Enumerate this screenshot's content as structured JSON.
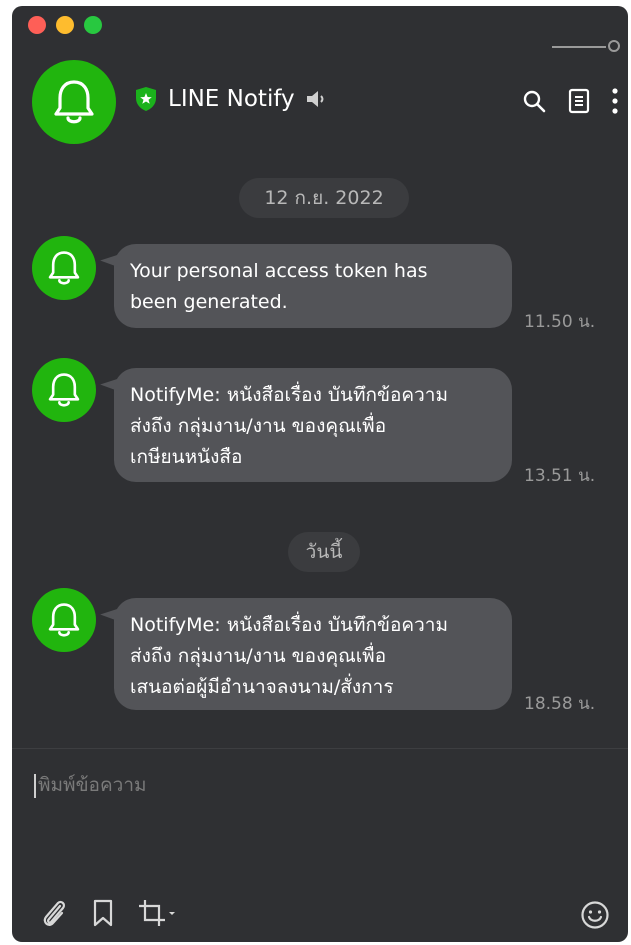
{
  "header": {
    "title": "LINE Notify",
    "icons": [
      "search-icon",
      "notes-icon",
      "more-icon"
    ]
  },
  "chat": {
    "date_1": "12 ก.ย. 2022",
    "date_2": "วันนี้",
    "messages": [
      {
        "line1": "Your personal access token has",
        "line2": "been generated.",
        "line3": "",
        "time": "11.50 น."
      },
      {
        "line1": "NotifyMe: หนังสือเรื่อง บันทึกข้อความ",
        "line2": "ส่งถึง กลุ่มงาน/งาน ของคุณเพื่อ",
        "line3": "เกษียนหนังสือ",
        "time": "13.51 น."
      },
      {
        "line1": "NotifyMe: หนังสือเรื่อง บันทึกข้อความ",
        "line2": "ส่งถึง กลุ่มงาน/งาน ของคุณเพื่อ",
        "line3": "เสนอต่อผู้มีอำนาจลงนาม/สั่งการ",
        "time": "18.58 น."
      }
    ]
  },
  "composer": {
    "placeholder": "พิมพ์ข้อความ"
  },
  "colors": {
    "window_bg": "#2f3033",
    "bubble_bg": "#535458",
    "line_green": "#21b50e",
    "shield_green": "#1bb21c"
  }
}
